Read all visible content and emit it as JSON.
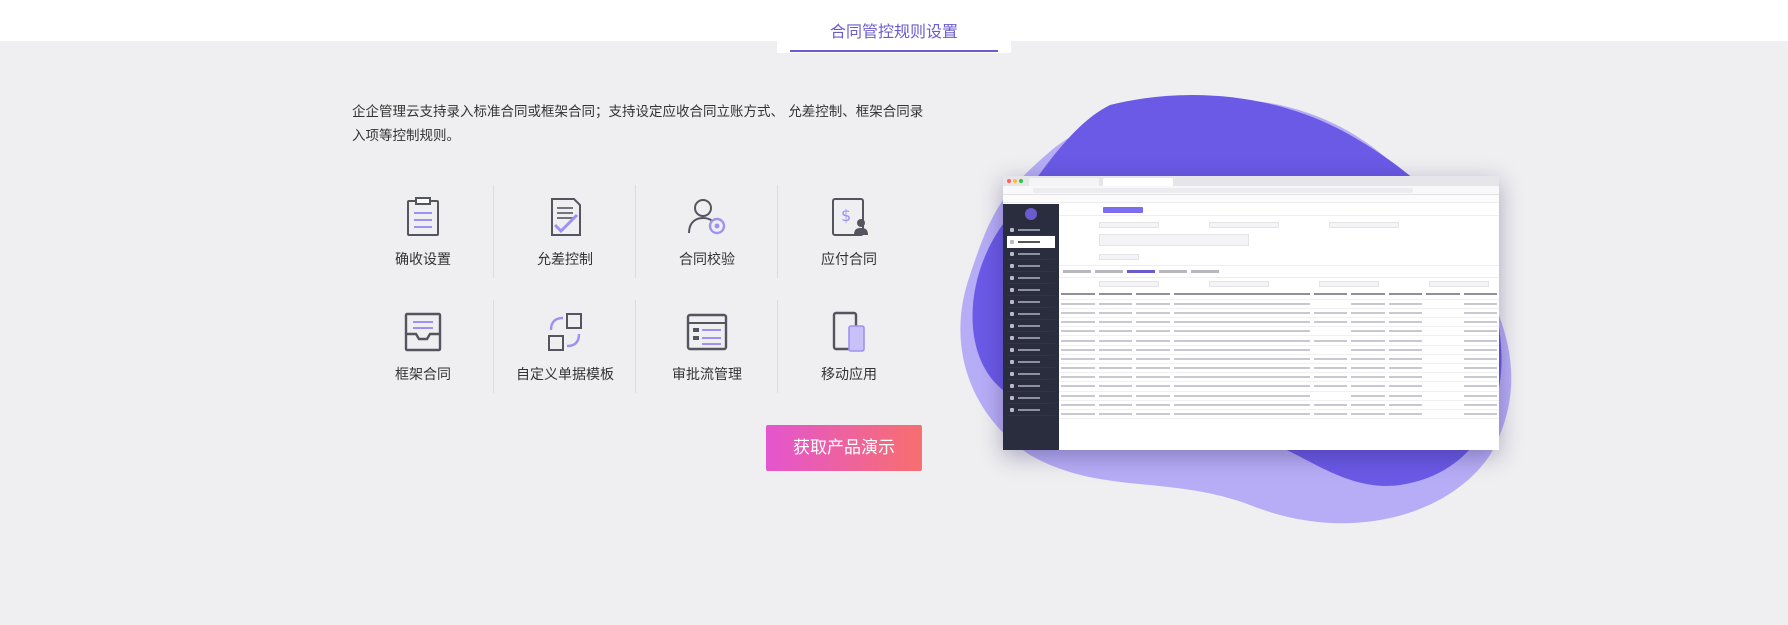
{
  "section": {
    "tab_title": "合同管控规则设置"
  },
  "description": "企企管理云支持录入标准合同或框架合同；支持设定应收合同立账方式、 允差控制、框架合同录入项等控制规则。",
  "features": [
    {
      "label": "确收设置",
      "icon": "clipboard-list-icon"
    },
    {
      "label": "允差控制",
      "icon": "document-check-icon"
    },
    {
      "label": "合同校验",
      "icon": "user-gear-icon"
    },
    {
      "label": "应付合同",
      "icon": "invoice-person-icon"
    },
    {
      "label": "框架合同",
      "icon": "inbox-tray-icon"
    },
    {
      "label": "自定义单据模板",
      "icon": "custom-blocks-icon"
    },
    {
      "label": "审批流管理",
      "icon": "browser-list-icon"
    },
    {
      "label": "移动应用",
      "icon": "mobile-devices-icon"
    }
  ],
  "cta": {
    "label": "获取产品演示"
  },
  "colors": {
    "accent": "#6a5ccf",
    "blob_dark": "#6b5ae6",
    "blob_light": "#b7adf6",
    "cta_start": "#e455cf",
    "cta_end": "#f76f6f",
    "icon_stroke": "#555560",
    "icon_accent": "#9d92f2"
  }
}
